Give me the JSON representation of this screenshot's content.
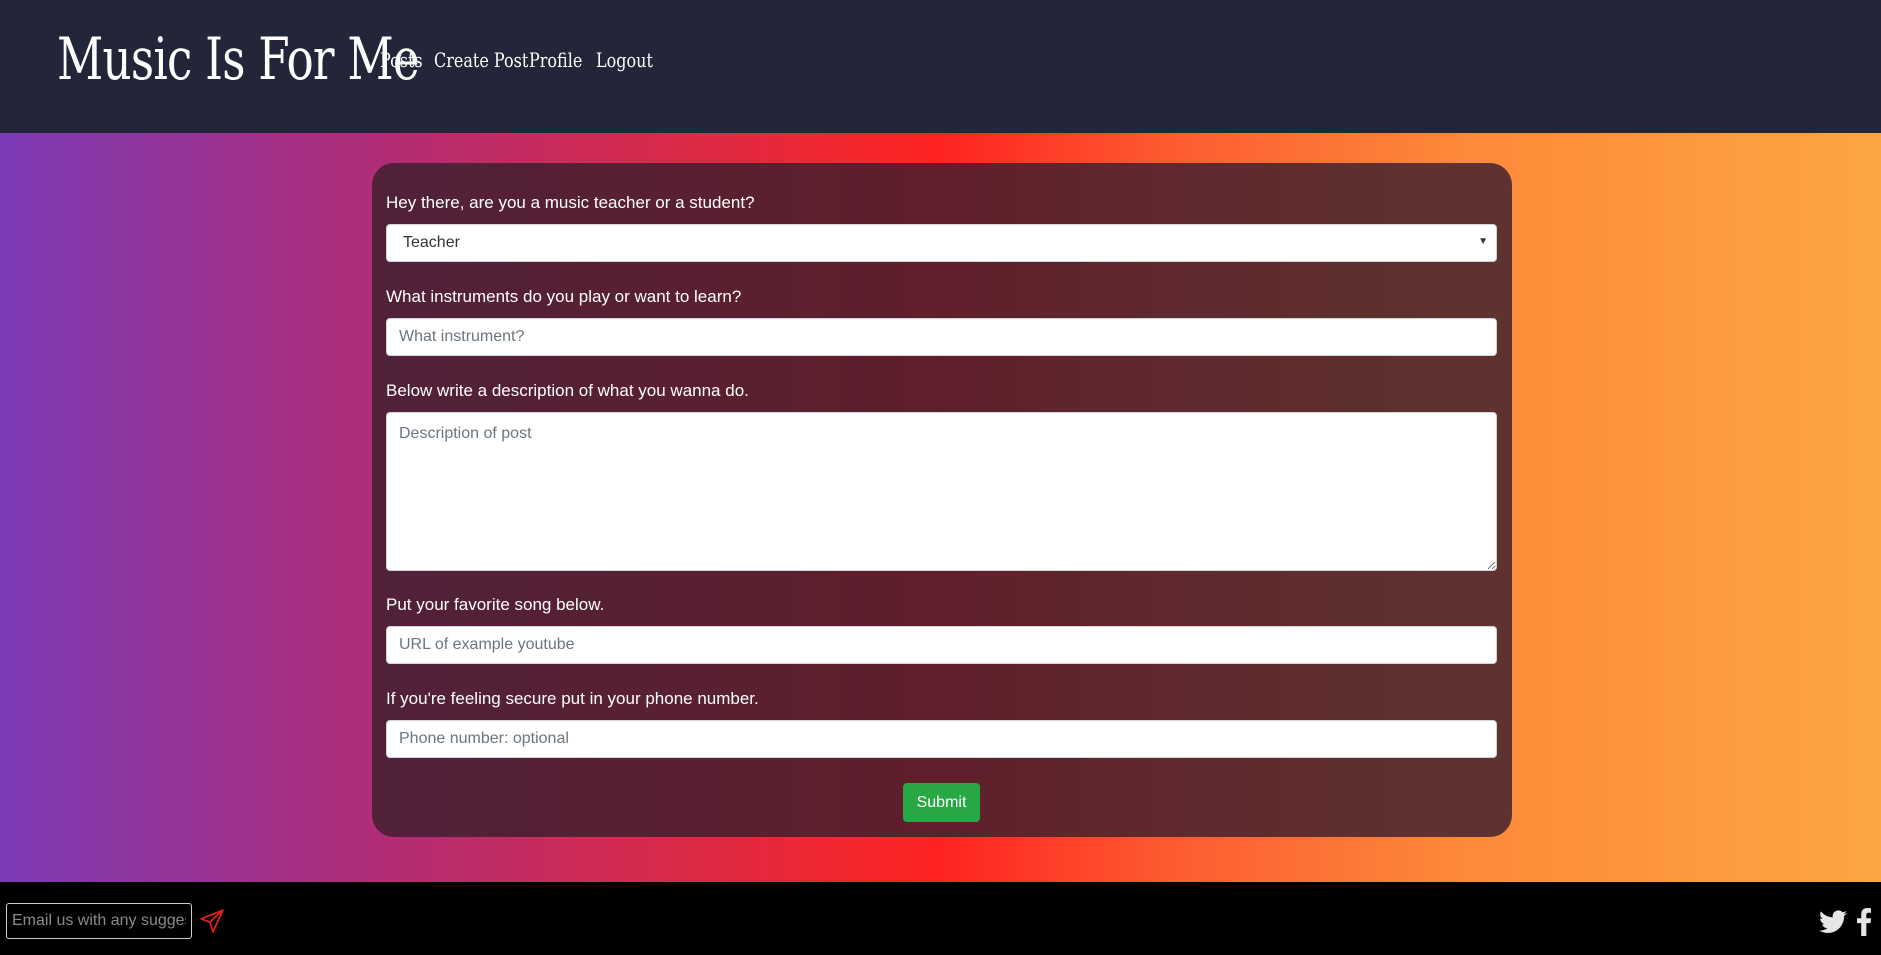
{
  "header": {
    "brand": "Music Is For Me",
    "nav": [
      "Posts",
      "Create Post",
      "Profile",
      "Logout"
    ]
  },
  "form": {
    "role_label": "Hey there, are you a music teacher or a student?",
    "role_value": "Teacher",
    "instrument_label": "What instruments do you play or want to learn?",
    "instrument_placeholder": "What instrument?",
    "description_label": "Below write a description of what you wanna do.",
    "description_placeholder": "Description of post",
    "song_label": "Put your favorite song below.",
    "song_placeholder": "URL of example youtube",
    "phone_label": "If you're feeling secure put in your phone number.",
    "phone_placeholder": "Phone number: optional",
    "submit_label": "Submit"
  },
  "footer": {
    "email_placeholder": "Email us with any suggestions",
    "icons": [
      "send-icon",
      "twitter-icon",
      "facebook-icon"
    ]
  },
  "colors": {
    "header_bg": "#222638",
    "submit_bg": "#28a745",
    "send_icon": "#e0201c"
  }
}
